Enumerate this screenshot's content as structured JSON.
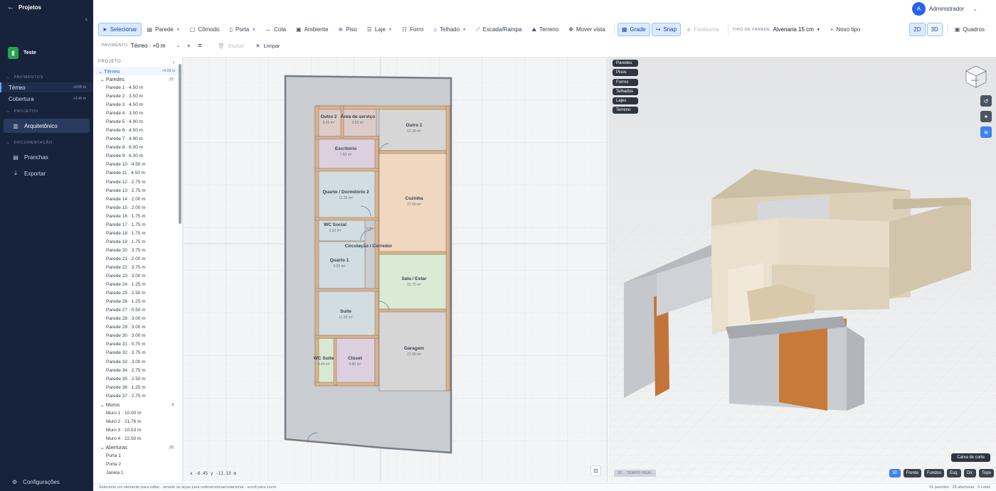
{
  "app": {
    "back_label": "Projetos",
    "collapse_icon": "chevron-left-icon"
  },
  "sidebar": {
    "project_name": "Teste",
    "sections": {
      "pavimentos": "PAVIMENTOS",
      "projetos": "PROJETOS",
      "documentacao": "DOCUMENTAÇÃO"
    },
    "levels": [
      {
        "name": "Térreo",
        "elevation": "+0.00 m"
      },
      {
        "name": "Cobertura",
        "elevation": "+3.45 m"
      }
    ],
    "projects": [
      {
        "label": "Arquitetônico",
        "icon": "building-icon"
      }
    ],
    "docs": [
      {
        "label": "Pranchas",
        "icon": "sheets-icon"
      },
      {
        "label": "Exportar",
        "icon": "download-icon"
      }
    ],
    "settings_label": "Configurações"
  },
  "user": {
    "initial": "A",
    "name": "Administrador"
  },
  "toolbar": {
    "tools": [
      {
        "label": "Selecionar",
        "icon": "cursor-icon",
        "glyph": "➤",
        "active": true
      },
      {
        "label": "Parede",
        "icon": "wall-icon",
        "glyph": "▤",
        "dropdown": true
      },
      {
        "label": "Cômodo",
        "icon": "room-icon",
        "glyph": "▢"
      },
      {
        "label": "Porta",
        "icon": "door-icon",
        "glyph": "▯",
        "dropdown": true
      },
      {
        "label": "Cota",
        "icon": "dimension-icon",
        "glyph": "↔"
      },
      {
        "label": "Ambiente",
        "icon": "environment-icon",
        "glyph": "▣"
      },
      {
        "label": "Piso",
        "icon": "floor-icon",
        "glyph": "≋"
      },
      {
        "label": "Laje",
        "icon": "slab-icon",
        "glyph": "☰",
        "dropdown": true
      },
      {
        "label": "Forro",
        "icon": "ceiling-icon",
        "glyph": "☷"
      },
      {
        "label": "Telhado",
        "icon": "roof-icon",
        "glyph": "⌂",
        "dropdown": true
      },
      {
        "label": "Escada/Rampa",
        "icon": "stairs-icon",
        "glyph": "⟋"
      },
      {
        "label": "Terreno",
        "icon": "terrain-icon",
        "glyph": "⛰"
      },
      {
        "label": "Mover vista",
        "icon": "move-icon",
        "glyph": "✥"
      }
    ],
    "grid_label": "Grade",
    "snap_label": "Snap",
    "ghost_label": "Fantasma",
    "wall_type_label": "TIPO DE PAREDE",
    "wall_type_value": "Alvenaria 15 cm",
    "new_type_label": "Novo tipo",
    "view_2d": "2D",
    "view_3d": "3D",
    "frames_label": "Quadros"
  },
  "toolbar2": {
    "pavimento_label": "PAVIMENTO",
    "pavimento_value": "Térreo · +0 m",
    "delete_label": "Excluir",
    "clear_label": "Limpar"
  },
  "panel": {
    "header": "PROJETO",
    "level": {
      "name": "Térreo",
      "elevation": "+0.00 m"
    },
    "groups": [
      {
        "name": "Paredes",
        "count": "37",
        "items": [
          "Parede 1 · 4.50 m",
          "Parede 2 · 3.50 m",
          "Parede 3 · 4.50 m",
          "Parede 4 · 3.50 m",
          "Parede 5 · 4.90 m",
          "Parede 6 · 4.50 m",
          "Parede 7 · 4.90 m",
          "Parede 8 · 6.00 m",
          "Parede 9 · 6.00 m",
          "Parede 10 · 4.50 m",
          "Parede 11 · 4.50 m",
          "Parede 12 · 2.75 m",
          "Parede 13 · 2.75 m",
          "Parede 14 · 2.00 m",
          "Parede 15 · 2.00 m",
          "Parede 16 · 1.75 m",
          "Parede 17 · 1.75 m",
          "Parede 18 · 1.75 m",
          "Parede 19 · 1.75 m",
          "Parede 20 · 3.75 m",
          "Parede 21 · 2.00 m",
          "Parede 22 · 3.75 m",
          "Parede 23 · 3.00 m",
          "Parede 24 · 1.25 m",
          "Parede 25 · 2.50 m",
          "Parede 26 · 1.25 m",
          "Parede 27 · 0.50 m",
          "Parede 28 · 3.00 m",
          "Parede 29 · 3.00 m",
          "Parede 30 · 3.00 m",
          "Parede 31 · 0.75 m",
          "Parede 32 · 3.75 m",
          "Parede 33 · 3.00 m",
          "Parede 34 · 2.75 m",
          "Parede 35 · 2.50 m",
          "Parede 36 · 1.25 m",
          "Parede 37 · 2.75 m"
        ]
      },
      {
        "name": "Muros",
        "count": "4",
        "items": [
          "Muro 1 · 10.00 m",
          "Muro 2 · 21.76 m",
          "Muro 3 · 10.53 m",
          "Muro 4 · 22.50 m"
        ]
      },
      {
        "name": "Aberturas",
        "count": "26",
        "items": [
          "Porta 1",
          "Porta 2",
          "Janela 1"
        ]
      }
    ]
  },
  "plan": {
    "rooms": [
      {
        "name": "Outro 2",
        "area": "3.06 m²",
        "color": "#dccbc9"
      },
      {
        "name": "Área de serviço",
        "area": "3.50 m²",
        "color": "#dccbc9"
      },
      {
        "name": "Outro 1",
        "area": "12.38 m²",
        "color": "#d6d6d6"
      },
      {
        "name": "Escritório",
        "area": "7.50 m²",
        "color": "#dcd0de"
      },
      {
        "name": "Cozinha",
        "area": "27.00 m²",
        "color": "#f0d7bf"
      },
      {
        "name": "Quarto / Dormitório 2",
        "area": "11.25 m²",
        "color": "#d2dde2"
      },
      {
        "name": "WC Social",
        "area": "3.33 m²",
        "color": "#d2dde2"
      },
      {
        "name": "Circulação / Corredor",
        "area": "",
        "color": "#e5e7eb"
      },
      {
        "name": "Quarto 1",
        "area": "9.00 m²",
        "color": "#d2dde2"
      },
      {
        "name": "Sala / Estar",
        "area": "15.75 m²",
        "color": "#d9ead5"
      },
      {
        "name": "Suíte",
        "area": "11.25 m²",
        "color": "#d2dde2"
      },
      {
        "name": "Garagem",
        "area": "22.65 m²",
        "color": "#d6d6d6"
      },
      {
        "name": "WC Suíte",
        "area": "4.44 m²",
        "color": "#d7e8d5"
      },
      {
        "name": "Closet",
        "area": "6.80 m²",
        "color": "#dcd0de"
      }
    ],
    "laje_label": "Laje",
    "coords": "x -6.45 y -11.13 m"
  },
  "viewport": {
    "layers": [
      "Paredes",
      "Pisos",
      "Forros",
      "Telhados",
      "Lajes",
      "Terreno"
    ],
    "cube_label": "FRONT",
    "section_box_label": "Caixa de corte",
    "realtime_label": "3D · TEMPO REAL",
    "views": [
      "3D",
      "Frente",
      "Fundos",
      "Esq.",
      "Dir.",
      "Topo"
    ]
  },
  "status": {
    "hint": "Selecione um elemento para editar · arraste as alças para redimensionar/rotacionar · scroll para zoom",
    "counts": "41 paredes · 28 aberturas · 0 cotas"
  }
}
